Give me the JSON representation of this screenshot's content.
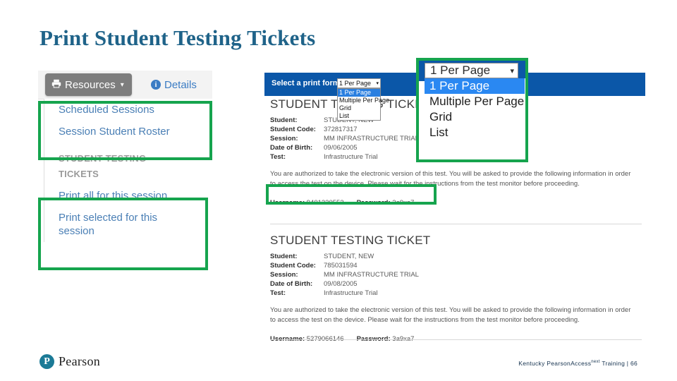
{
  "slide": {
    "title": "Print Student Testing Tickets",
    "title_color": "#1F6389"
  },
  "left_panel": {
    "toolbar": {
      "resources_label": "Resources",
      "resources_caret": "▾",
      "details_label": "Details",
      "info_glyph": "i"
    },
    "menu": {
      "items": [
        {
          "label": "Scheduled Sessions"
        },
        {
          "label": "Session Student Roster"
        }
      ],
      "section_label_line1": "STUDENT TESTING",
      "section_label_line2": "TICKETS",
      "print_items": [
        {
          "label": "Print all for this session"
        },
        {
          "label": "Print selected for this session"
        }
      ]
    }
  },
  "preview": {
    "print_format": {
      "label": "Select a print format",
      "selected": "1 Per Page",
      "caret": "▾",
      "options": [
        "1 Per Page",
        "Multiple Per Page",
        "Grid",
        "List"
      ]
    },
    "tickets": [
      {
        "title": "STUDENT TESTING TICKET",
        "fields": [
          {
            "key": "Student:",
            "value": "STUDENT, NEW"
          },
          {
            "key": "Student Code:",
            "value": "372817317"
          },
          {
            "key": "Session:",
            "value": "MM INFRASTRUCTURE TRIAL"
          },
          {
            "key": "Date of Birth:",
            "value": "09/06/2005"
          },
          {
            "key": "Test:",
            "value": "Infrastructure Trial"
          }
        ],
        "note": "You are authorized to take the electronic version of this test. You will be asked to provide the following information in order to access the test on the device. Please wait for the instructions from the test monitor before proceeding.",
        "username_label": "Username:",
        "username": "9401330552",
        "password_label": "Password:",
        "password": "3a9xa7"
      },
      {
        "title": "STUDENT TESTING TICKET",
        "fields": [
          {
            "key": "Student:",
            "value": "STUDENT, NEW"
          },
          {
            "key": "Student Code:",
            "value": "785031594"
          },
          {
            "key": "Session:",
            "value": "MM INFRASTRUCTURE TRIAL"
          },
          {
            "key": "Date of Birth:",
            "value": "09/08/2005"
          },
          {
            "key": "Test:",
            "value": "Infrastructure Trial"
          }
        ],
        "note": "You are authorized to take the electronic version of this test. You will be asked to provide the following information in order to access the test on the device. Please wait for the instructions from the test monitor before proceeding.",
        "username_label": "Username:",
        "username": "5279066146",
        "password_label": "Password:",
        "password": "3a9xa7"
      }
    ]
  },
  "callout": {
    "combo_value": "1 Per Page",
    "caret": "▾",
    "options": [
      "1 Per Page",
      "Multiple Per Page",
      "Grid",
      "List"
    ]
  },
  "footer": {
    "logo_mark": "P",
    "logo_word": "Pearson",
    "note_main": "Kentucky PearsonAccess",
    "note_sup": "next",
    "note_tail": " Training | 66"
  },
  "colors": {
    "highlight_green": "#16a44e",
    "header_blue": "#0B57A8",
    "link_blue": "#4a7fb5",
    "title_teal": "#1F6389"
  }
}
